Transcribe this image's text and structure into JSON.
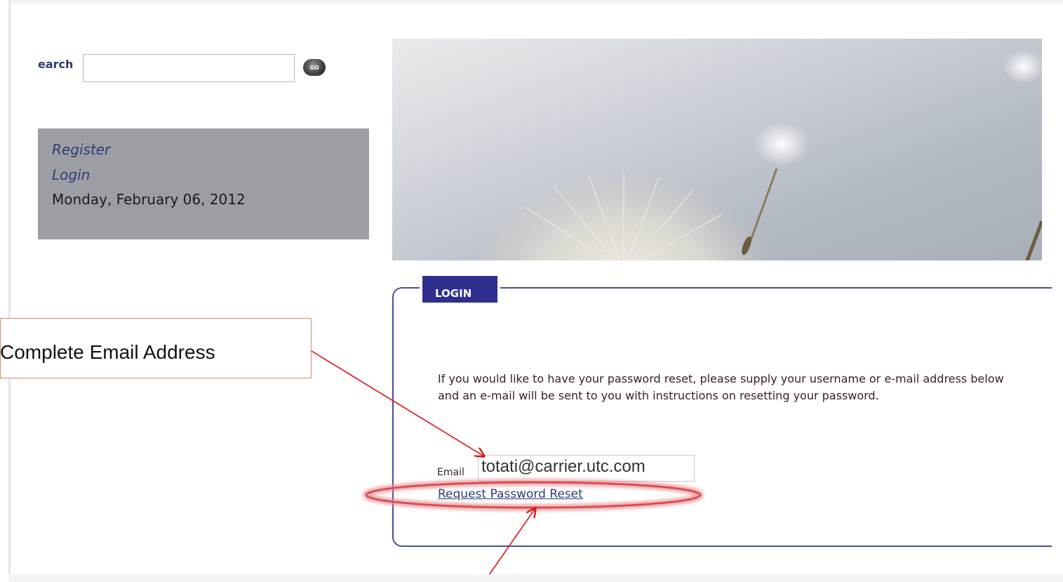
{
  "search": {
    "label": "earch",
    "placeholder": "",
    "go_label": "GO"
  },
  "user_panel": {
    "register_label": "Register",
    "login_label": "Login",
    "date": "Monday, February 06, 2012"
  },
  "login": {
    "tab_label": "LOGIN",
    "instructions": "If you would like to have your password reset, please supply your username or e-mail address below and an e-mail will be sent to you with instructions on resetting your password.",
    "email_label": "Email",
    "email_value": "totati@carrier.utc.com",
    "reset_link_label": "Request Password Reset"
  },
  "annotations": {
    "callout_text": "Complete Email Address",
    "arrow_color": "#e01010",
    "highlight_color": "#d9454a"
  },
  "colors": {
    "link": "#2d3d7a",
    "login_tab": "#2f2f8f",
    "login_border": "#4b4f97",
    "panel_bg": "#9d9ea3"
  }
}
